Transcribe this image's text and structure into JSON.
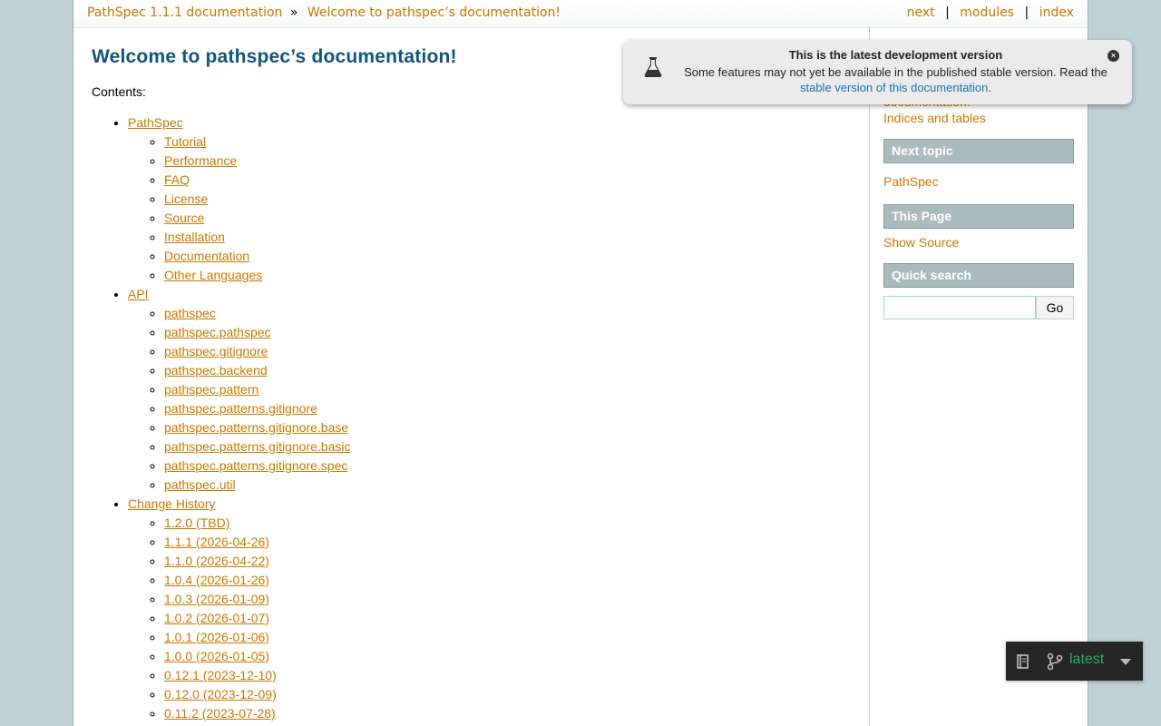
{
  "related": {
    "crumbs": [
      {
        "label": "PathSpec 1.1.1 documentation"
      },
      {
        "label": "Welcome to pathspec’s documentation!"
      }
    ],
    "crumb_separator": "»",
    "right_links": [
      {
        "label": "next"
      },
      {
        "label": "modules"
      },
      {
        "label": "index"
      }
    ],
    "right_separator": "|"
  },
  "main": {
    "title": "Welcome to pathspec’s documentation!",
    "contents_label": "Contents:",
    "toc": [
      {
        "label": "PathSpec",
        "children": [
          "Tutorial",
          "Performance",
          "FAQ",
          "License",
          "Source",
          "Installation",
          "Documentation",
          "Other Languages"
        ]
      },
      {
        "label": "API",
        "children": [
          "pathspec",
          "pathspec.pathspec",
          "pathspec.gitignore",
          "pathspec.backend",
          "pathspec.pattern",
          "pathspec.patterns.gitignore",
          "pathspec.patterns.gitignore.base",
          "pathspec.patterns.gitignore.basic",
          "pathspec.patterns.gitignore.spec",
          "pathspec.util"
        ]
      },
      {
        "label": "Change History",
        "children": [
          "1.2.0 (TBD)",
          "1.1.1 (2026-04-26)",
          "1.1.0 (2026-04-22)",
          "1.0.4 (2026-01-26)",
          "1.0.3 (2026-01-09)",
          "1.0.2 (2026-01-07)",
          "1.0.1 (2026-01-06)",
          "1.0.0 (2026-01-05)",
          "0.12.1 (2023-12-10)",
          "0.12.0 (2023-12-09)",
          "0.11.2 (2023-07-28)"
        ]
      }
    ]
  },
  "sidebar": {
    "partial_link": "documentation!",
    "indices_link": "Indices and tables",
    "next_topic_heading": "Next topic",
    "next_topic_link": "PathSpec",
    "this_page_heading": "This Page",
    "show_source_link": "Show Source",
    "quick_search_heading": "Quick search",
    "search_input_value": "",
    "search_button_label": "Go"
  },
  "popup": {
    "title": "This is the latest development version",
    "message_before": "Some features may not yet be available in the published stable version. Read the ",
    "message_link": "stable version of this documentation",
    "message_after": ".",
    "close_symbol": "×",
    "icon": "flask-icon"
  },
  "version_badge": {
    "label": "latest",
    "icons": [
      "book-icon",
      "git-branch-icon",
      "caret-down-icon"
    ]
  },
  "colors": {
    "background": "#bfd1d4",
    "link": "#ca7900",
    "title": "#11557c",
    "sidebar_heading_bg": "#aabbc0",
    "popup_link": "#1a73b8",
    "badge_bg": "#262626",
    "badge_text": "#27ae60"
  }
}
